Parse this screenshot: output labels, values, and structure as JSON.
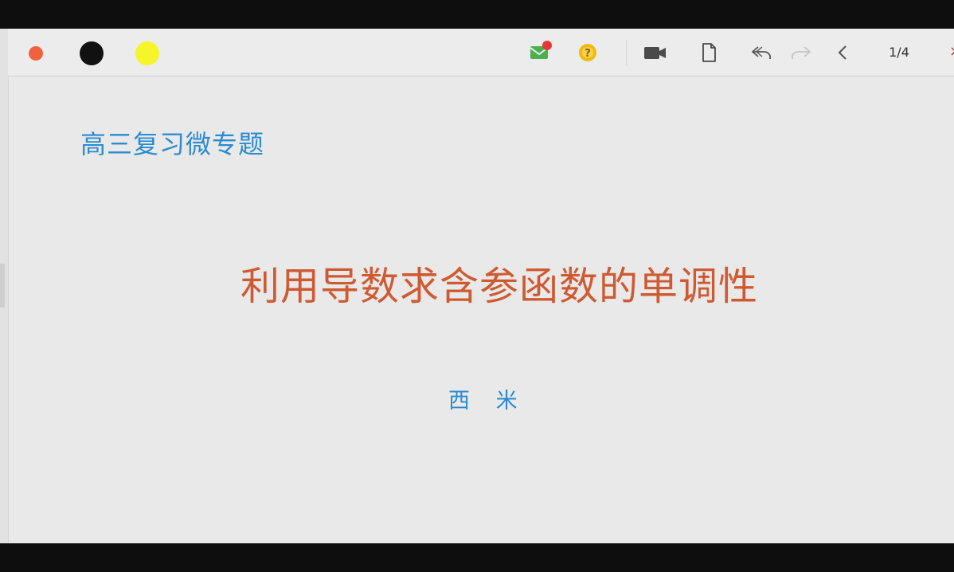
{
  "toolbar": {
    "pen_colors": [
      {
        "name": "red-pen",
        "color": "#f0613c"
      },
      {
        "name": "black-pen",
        "color": "#111111"
      },
      {
        "name": "yellow-pen",
        "color": "#f5f52a"
      }
    ],
    "icons": [
      "mail-icon",
      "help-icon",
      "video-icon",
      "document-icon",
      "undo-icon",
      "redo-icon",
      "previous-icon"
    ],
    "page_indicator": "1/4",
    "close_glyph": "×"
  },
  "slide": {
    "subtitle": "高三复习微专题",
    "title": "利用导数求含参函数的单调性",
    "author": "西 米"
  },
  "colors": {
    "title": "#cf5a32",
    "accent_blue": "#2a8bd0",
    "background": "#e9e9e9",
    "mail_green": "#4caf50",
    "notify_red": "#e53935",
    "help_yellow": "#f2b90f"
  }
}
